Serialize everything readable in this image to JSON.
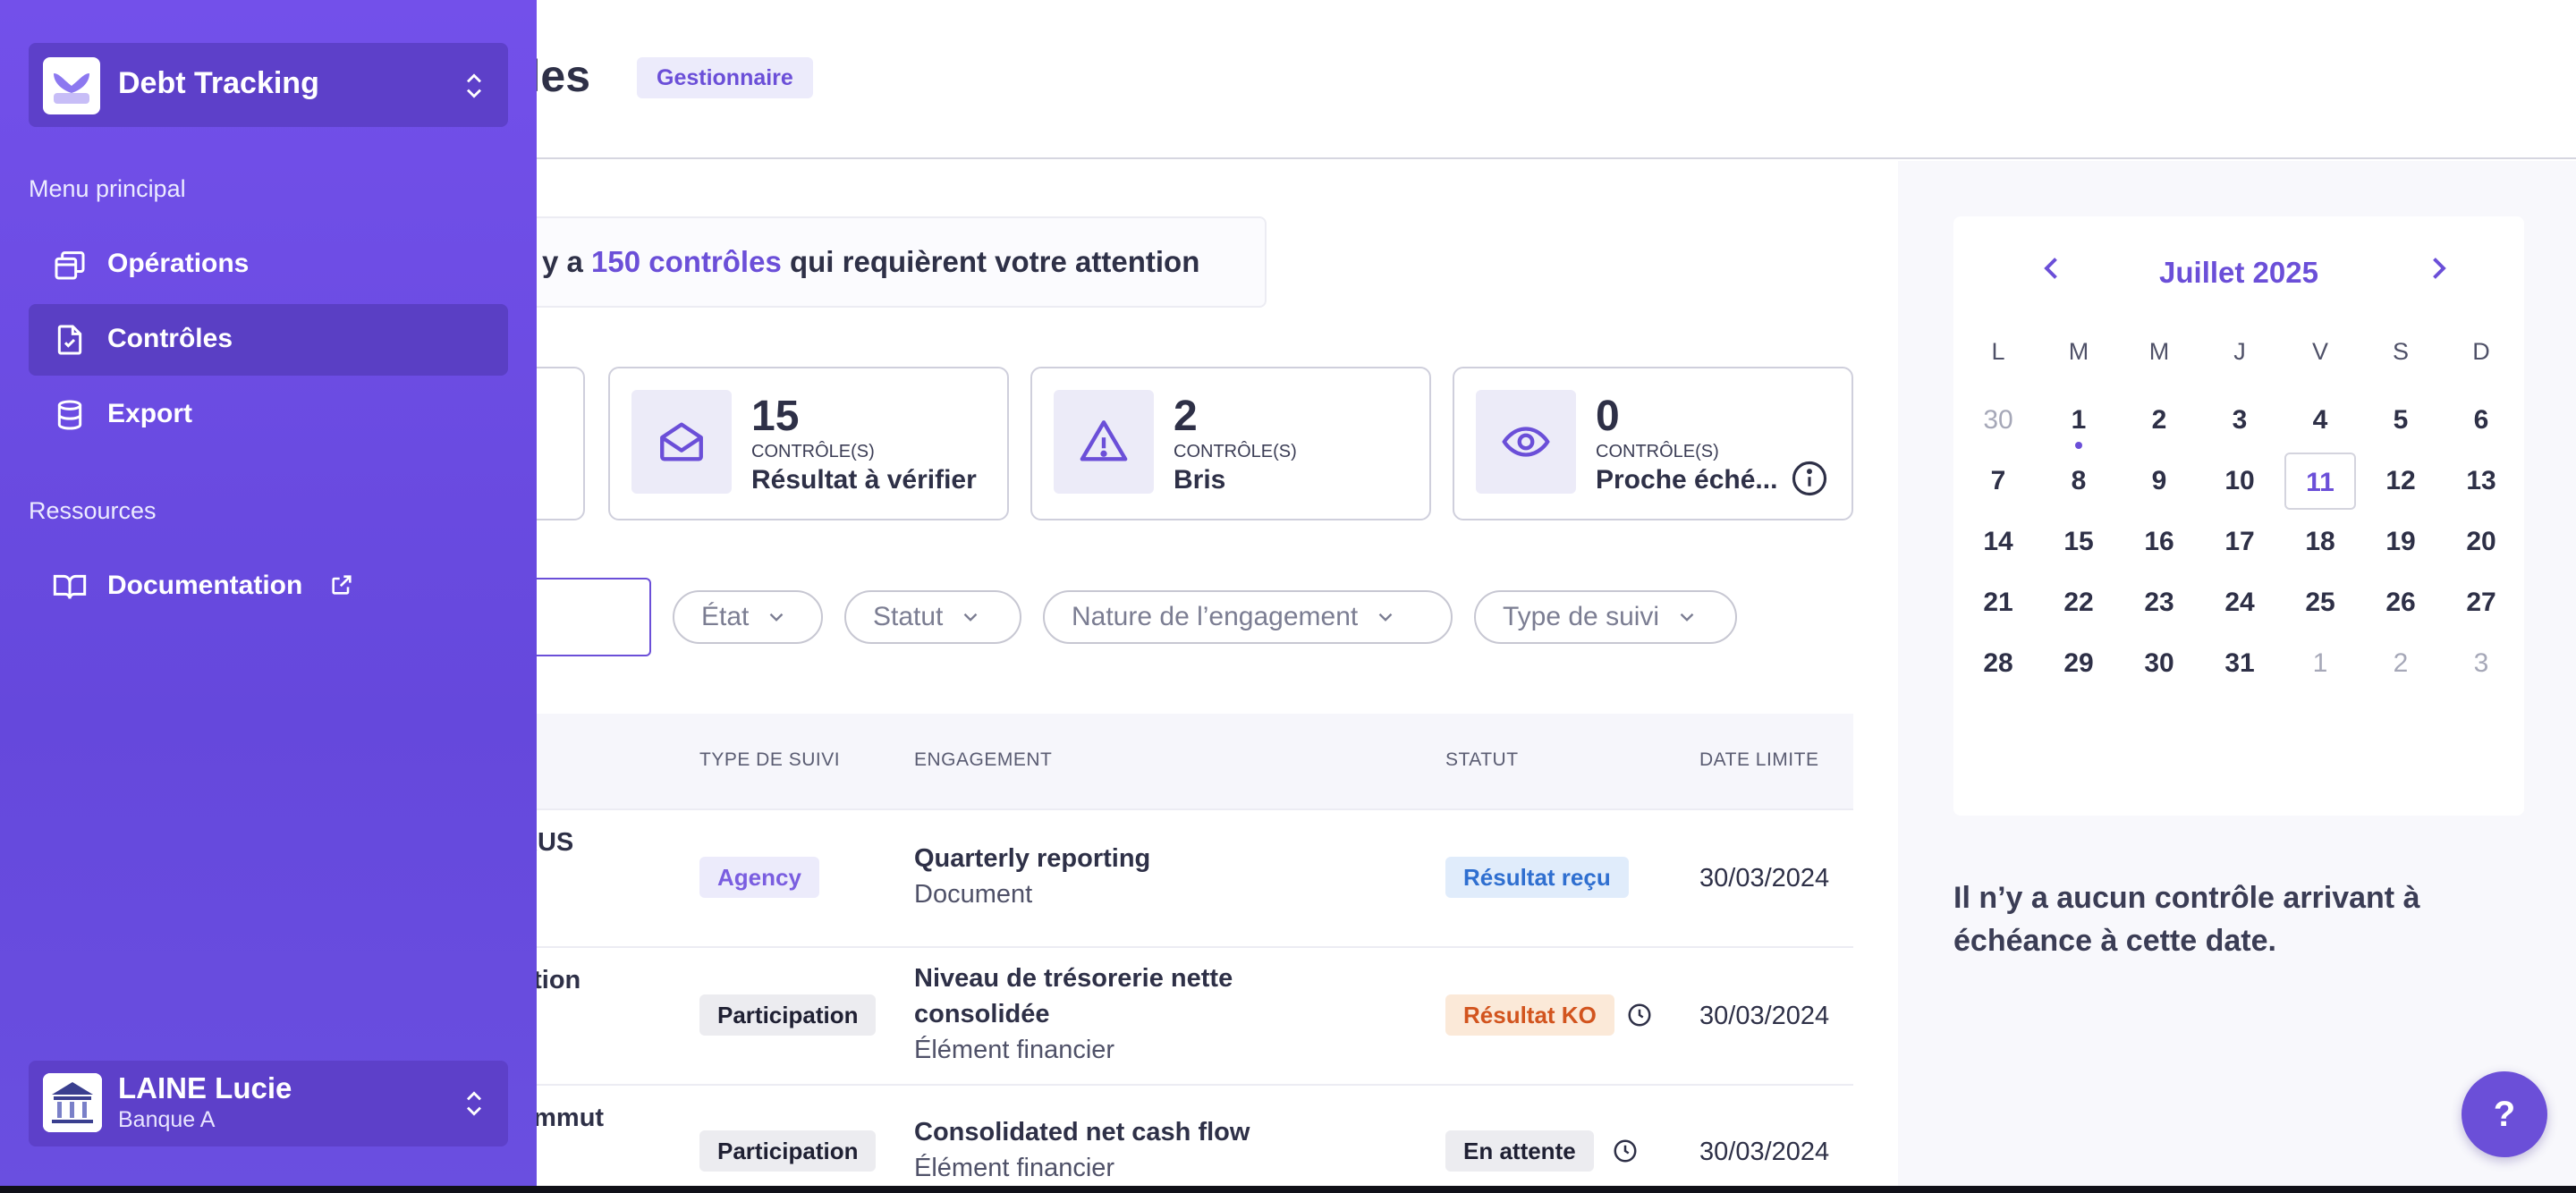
{
  "header": {
    "title_fragment": "ôles",
    "role_badge": "Gestionnaire"
  },
  "alert": {
    "prefix": "y a ",
    "count_text": "150 contrôles",
    "suffix": " qui requièrent votre attention"
  },
  "stats": [
    {
      "count": "15",
      "unit": "CONTRÔLE(S)",
      "label": "Résultat à vérifier",
      "icon": "envelope-open-icon"
    },
    {
      "count": "2",
      "unit": "CONTRÔLE(S)",
      "label": "Bris",
      "icon": "warning-triangle-icon"
    },
    {
      "count": "0",
      "unit": "CONTRÔLE(S)",
      "label": "Proche éché...",
      "icon": "eye-icon"
    }
  ],
  "filters": [
    "État",
    "Statut",
    "Nature de l’engagement",
    "Type de suivi"
  ],
  "table": {
    "columns": [
      "TYPE DE SUIVI",
      "ENGAGEMENT",
      "STATUT",
      "DATE LIMITE"
    ],
    "rows": [
      {
        "name_fragment": "RUS",
        "type": "Agency",
        "engagement": "Quarterly reporting",
        "engagement_sub": "Document",
        "status": "Résultat reçu",
        "date": "30/03/2024"
      },
      {
        "name_fragment": "ation",
        "type": "Participation",
        "engagement": "Niveau de trésorerie nette",
        "engagement_line2": "consolidée",
        "engagement_sub": "Élément financier",
        "status": "Résultat KO",
        "date": "30/03/2024"
      },
      {
        "name_fragment": "ammut",
        "type": "Participation",
        "engagement": "Consolidated net cash flow",
        "engagement_sub": "Élément financier",
        "status": "En attente",
        "date": "30/03/2024"
      }
    ]
  },
  "calendar": {
    "month": "Juillet 2025",
    "weekdays": [
      "L",
      "M",
      "M",
      "J",
      "V",
      "S",
      "D"
    ],
    "weeks": [
      [
        "30",
        "1",
        "2",
        "3",
        "4",
        "5",
        "6"
      ],
      [
        "7",
        "8",
        "9",
        "10",
        "11",
        "12",
        "13"
      ],
      [
        "14",
        "15",
        "16",
        "17",
        "18",
        "19",
        "20"
      ],
      [
        "21",
        "22",
        "23",
        "24",
        "25",
        "26",
        "27"
      ],
      [
        "28",
        "29",
        "30",
        "31",
        "1",
        "2",
        "3"
      ]
    ],
    "selected_day": "11",
    "empty_message": "Il n’y a aucun contrôle arrivant à échéance à cette date."
  },
  "help_label": "?",
  "sidebar": {
    "app_name": "Debt Tracking",
    "main_menu_label": "Menu principal",
    "items": [
      {
        "label": "Opérations",
        "icon": "operations-icon"
      },
      {
        "label": "Contrôles",
        "icon": "document-check-icon",
        "active": true
      },
      {
        "label": "Export",
        "icon": "database-icon"
      }
    ],
    "resources_label": "Ressources",
    "resources": [
      {
        "label": "Documentation",
        "icon": "book-icon"
      }
    ],
    "user": {
      "name": "LAINE Lucie",
      "org": "Banque A"
    }
  },
  "colors": {
    "accent": "#6b4fd8",
    "drawer": "#6a4ce2"
  }
}
